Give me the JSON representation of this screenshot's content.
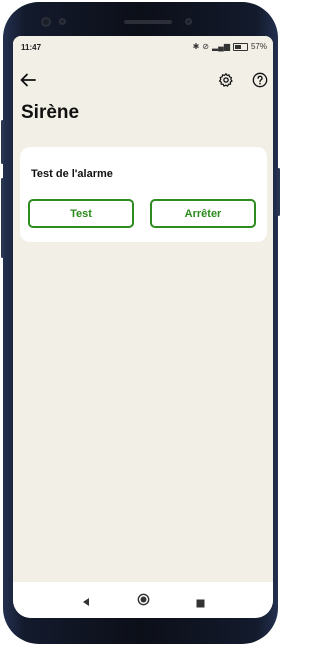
{
  "status_bar": {
    "time": "11:47",
    "battery_text": "57%",
    "icons": [
      "bluetooth-icon",
      "mute-icon",
      "signal-icon",
      "battery-icon"
    ]
  },
  "app_bar": {
    "icons": [
      "back-arrow-icon",
      "gear-icon",
      "help-icon"
    ]
  },
  "page": {
    "title": "Sirène"
  },
  "alarm_card": {
    "title": "Test de l'alarme",
    "test_label": "Test",
    "stop_label": "Arrêter"
  },
  "nav_bar": {
    "icons": [
      "back-triangle-icon",
      "home-circle-icon",
      "recents-square-icon"
    ]
  },
  "colors": {
    "accent": "#2e8b1f",
    "background": "#f2efe6",
    "card": "#ffffff"
  }
}
